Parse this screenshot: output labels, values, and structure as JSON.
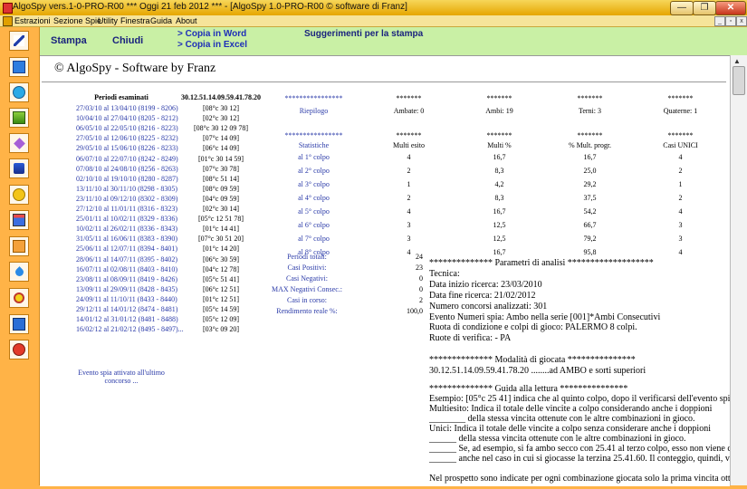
{
  "window": {
    "title": "AlgoSpy vers.1-0-PRO-R00  ***  Oggi 21 feb 2012  ***  - [AlgoSpy 1.0-PRO-R00   © software di Franz]"
  },
  "menu": [
    "Estrazioni",
    "Sezione Spie",
    "Utility",
    "Finestra",
    "Guida",
    "About"
  ],
  "toolbar": {
    "stampa": "Stampa",
    "chiudi": "Chiudi",
    "copia_word": "> Copia in Word",
    "copia_excel": "> Copia in Excel",
    "suggerimenti": "Suggerimenti per la stampa"
  },
  "left_toolbar_icons": [
    "pencil-icon",
    "monitor-icon",
    "refresh-icon",
    "chart-icon",
    "diamond-icon",
    "tools-icon",
    "dollar-icon",
    "tree-icon",
    "grid-icon",
    "drop-icon",
    "target-icon",
    "book-icon",
    "power-icon"
  ],
  "report": {
    "copyright": "© AlgoSpy - Software by Franz",
    "periodi_header": "Periodi esaminati",
    "combo_header": "30.12.51.14.09.59.41.78.20",
    "periods": [
      {
        "p": "27/03/10 al 13/04/10 (8199 - 8206)",
        "r": "[08°c 30 12]"
      },
      {
        "p": "10/04/10 al 27/04/10 (8205 - 8212)",
        "r": "[02°c 30 12]"
      },
      {
        "p": "06/05/10 al 22/05/10 (8216 - 8223)",
        "r": "[08°c 30 12 09 78]"
      },
      {
        "p": "27/05/10 al 12/06/10 (8225 - 8232)",
        "r": "[07°c 14 09]"
      },
      {
        "p": "29/05/10 al 15/06/10 (8226 - 8233)",
        "r": "[06°c 14 09]"
      },
      {
        "p": "06/07/10 al 22/07/10 (8242 - 8249)",
        "r": "[01°c 30 14 59]"
      },
      {
        "p": "07/08/10 al 24/08/10 (8256 - 8263)",
        "r": "[07°c 30 78]"
      },
      {
        "p": "02/10/10 al 19/10/10 (8280 - 8287)",
        "r": "[08°c 51 14]"
      },
      {
        "p": "13/11/10 al 30/11/10 (8298 - 8305)",
        "r": "[08°c 09 59]"
      },
      {
        "p": "23/11/10 al 09/12/10 (8302 - 8309)",
        "r": "[04°c 09 59]"
      },
      {
        "p": "27/12/10 al 11/01/11 (8316 - 8323)",
        "r": "[02°c 30 14]"
      },
      {
        "p": "25/01/11 al 10/02/11 (8329 - 8336)",
        "r": "[05°c 12 51 78]"
      },
      {
        "p": "10/02/11 al 26/02/11 (8336 - 8343)",
        "r": "[01°c 14 41]"
      },
      {
        "p": "31/05/11 al 16/06/11 (8383 - 8390)",
        "r": "[07°c 30 51 20]"
      },
      {
        "p": "25/06/11 al 12/07/11 (8394 - 8401)",
        "r": "[01°c 14 20]"
      },
      {
        "p": "28/06/11 al 14/07/11 (8395 - 8402)",
        "r": "[06°c 30 59]"
      },
      {
        "p": "16/07/11 al 02/08/11 (8403 - 8410)",
        "r": "[04°c 12 78]"
      },
      {
        "p": "23/08/11 al 08/09/11 (8419 - 8426)",
        "r": "[05°c 51 41]"
      },
      {
        "p": "13/09/11 al 29/09/11 (8428 - 8435)",
        "r": "[06°c 12 51]"
      },
      {
        "p": "24/09/11 al 11/10/11 (8433 - 8440)",
        "r": "[01°c 12 51]"
      },
      {
        "p": "29/12/11 al 14/01/12 (8474 - 8481)",
        "r": "[05°c 14 59]"
      },
      {
        "p": "14/01/12 al 31/01/12 (8481 - 8488)",
        "r": "[05°c 12 09]"
      },
      {
        "p": "16/02/12 al 21/02/12 (8495 - 8497)...",
        "r": "[03°c 09 20]"
      }
    ],
    "evento_note": [
      "Evento spia attivato all'ultimo",
      "concorso ..."
    ],
    "stars_short": "*******",
    "stars_long": "****************",
    "riepilogo": "Riepilogo",
    "summary": [
      "Ambate: 0",
      "Ambi: 19",
      "Terni: 3",
      "Quaterne: 1"
    ],
    "stat_header": [
      "Statistiche",
      "Multi esito",
      "Multi %",
      "% Mult. progr.",
      "Casi UNICI"
    ],
    "stat_rows": [
      {
        "l": "al 1° colpo",
        "a": "4",
        "b": "16,7",
        "c": "16,7",
        "d": "4"
      },
      {
        "l": "al 2° colpo",
        "a": "2",
        "b": "8,3",
        "c": "25,0",
        "d": "2"
      },
      {
        "l": "al 3° colpo",
        "a": "1",
        "b": "4,2",
        "c": "29,2",
        "d": "1"
      },
      {
        "l": "al 4° colpo",
        "a": "2",
        "b": "8,3",
        "c": "37,5",
        "d": "2"
      },
      {
        "l": "al 5° colpo",
        "a": "4",
        "b": "16,7",
        "c": "54,2",
        "d": "4"
      },
      {
        "l": "al 6° colpo",
        "a": "3",
        "b": "12,5",
        "c": "66,7",
        "d": "3"
      },
      {
        "l": "al 7° colpo",
        "a": "3",
        "b": "12,5",
        "c": "79,2",
        "d": "3"
      },
      {
        "l": "al 8° colpo",
        "a": "4",
        "b": "16,7",
        "c": "95,8",
        "d": "4"
      }
    ],
    "totals": [
      {
        "l": "Periodi totali:",
        "v": "24"
      },
      {
        "l": "Casi Positivi:",
        "v": "23"
      },
      {
        "l": "Casi Negativi:",
        "v": "0"
      },
      {
        "l": "MAX Negativi Consec.:",
        "v": "0"
      },
      {
        "l": "Casi in corso:",
        "v": "2"
      },
      {
        "l": "Rendimento reale %:",
        "v": "100,0"
      }
    ],
    "analysis_lines": [
      "************** Parametri di analisi *******************",
      "Tecnica:",
      "Data inizio ricerca: 23/03/2010",
      "Data fine ricerca: 21/02/2012",
      "Numero concorsi analizzati: 301",
      "Evento Numeri spia: Ambo nella serie [001]*Ambi Consecutivi",
      "Ruota di condizione e colpi di gioco: PALERMO 8 colpi.",
      "Ruote di verifica: - PA",
      "",
      "************** Modalità di giocata ***************",
      "30.12.51.14.09.59.41.78.20 ........ad AMBO e sorti superiori"
    ],
    "guide_lines": [
      "************** Guida alla lettura ***************",
      "Esempio: [05°c 25 41] indica che al quinto colpo, dopo il verificarsi dell'evento spia, è sortito l'an",
      "Multiesito: Indica il totale delle vincite a colpo considerando anche i doppioni",
      "________ della stessa vincita ottenute con le altre combinazioni in gioco.",
      "Unici: Indica il totale delle vincite a colpo senza considerare anche i doppioni",
      "______ della stessa vincita ottenute con le altre combinazioni in gioco.",
      "______ Se, ad esempio, si fa ambo secco con 25.41 al terzo colpo, esso non viene conteggiato",
      "______ anche nel caso in cui si giocasse la terzina 25.41.60. Il conteggio, quindi, viene arrestato",
      "",
      "Nel prospetto sono indicate per ogni combinazione giocata solo la prima vincita ottenuta di valore"
    ]
  }
}
